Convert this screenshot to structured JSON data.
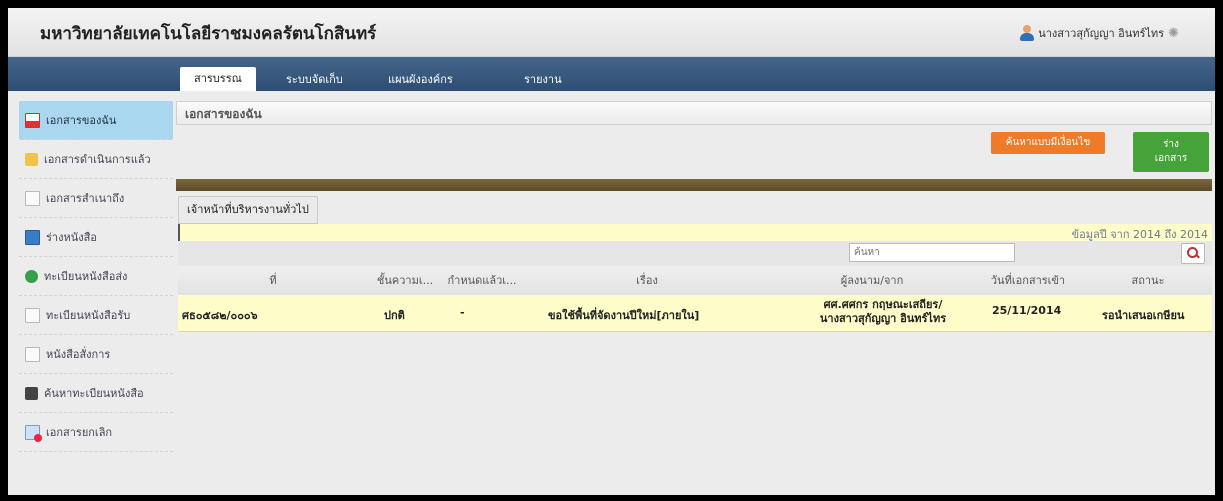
{
  "app": {
    "title": "มหาวิทยาลัยเทคโนโลยีราชมงคลรัตนโกสินทร์"
  },
  "user": {
    "name": "นางสาวสุกัญญา อินทร์ไทร"
  },
  "nav": {
    "tabs": [
      {
        "label": "สารบรรณ",
        "active": true
      },
      {
        "label": "ระบบจัดเก็บ",
        "active": false
      },
      {
        "label": "แผนผังองค์กร",
        "active": false
      },
      {
        "label": "รายงาน",
        "active": false
      }
    ]
  },
  "sidebar": {
    "items": [
      {
        "label": "เอกสารของฉัน",
        "icon": "my-documents-icon",
        "active": true
      },
      {
        "label": "เอกสารดำเนินการแล้ว",
        "icon": "processed-folder-icon",
        "active": false
      },
      {
        "label": "เอกสารสำเนาถึง",
        "icon": "copy-document-icon",
        "active": false
      },
      {
        "label": "ร่างหนังสือ",
        "icon": "draft-letter-icon",
        "active": false
      },
      {
        "label": "ทะเบียนหนังสือส่ง",
        "icon": "sent-register-icon",
        "active": false
      },
      {
        "label": "ทะเบียนหนังสือรับ",
        "icon": "received-register-icon",
        "active": false
      },
      {
        "label": "หนังสือสั่งการ",
        "icon": "order-letter-icon",
        "active": false
      },
      {
        "label": "ค้นหาทะเบียนหนังสือ",
        "icon": "search-register-icon",
        "active": false
      },
      {
        "label": "เอกสารยกเลิก",
        "icon": "cancelled-document-icon",
        "active": false
      }
    ]
  },
  "main": {
    "page_title": "เอกสารของฉัน",
    "buttons": {
      "search_advanced": "ค้นหาแบบมีเงื่อนไข",
      "draft_document": "ร่าง\nเอกสาร"
    },
    "department_tab": "เจ้าหน้าที่บริหารงานทั่วไป",
    "data_range": "ข้อมูลปี จาก 2014 ถึง 2014",
    "search": {
      "placeholder": "ค้นหา"
    },
    "table": {
      "columns": [
        "ที่",
        "ชั้นความเ...",
        "กำหนดแล้วเ...",
        "เรื่อง",
        "ผู้ลงนาม/จาก",
        "วันที่เอกสารเข้า",
        "สถานะ"
      ],
      "rows": [
        {
          "number": "ศธ๐๕๘๒/๐๐๐๖",
          "secrecy": "ปกติ",
          "deadline": "-",
          "subject": "ขอใช้พื้นที่จัดงานปีใหม่[ภายใน]",
          "sender_line1": "ศศ.ศศกร กฤษณะเสถียร/",
          "sender_line2": "นางสาวสุกัญญา อินทร์ไทร",
          "date_in": "25/11/2014",
          "status": "รอนำเสนอเกษียน"
        }
      ]
    }
  },
  "colors": {
    "nav_bg": "#3a5a80",
    "sidebar_active": "#a9d7f0",
    "search_button": "#ef7a28",
    "draft_button": "#46a33a",
    "row_highlight": "#fefcc8"
  }
}
